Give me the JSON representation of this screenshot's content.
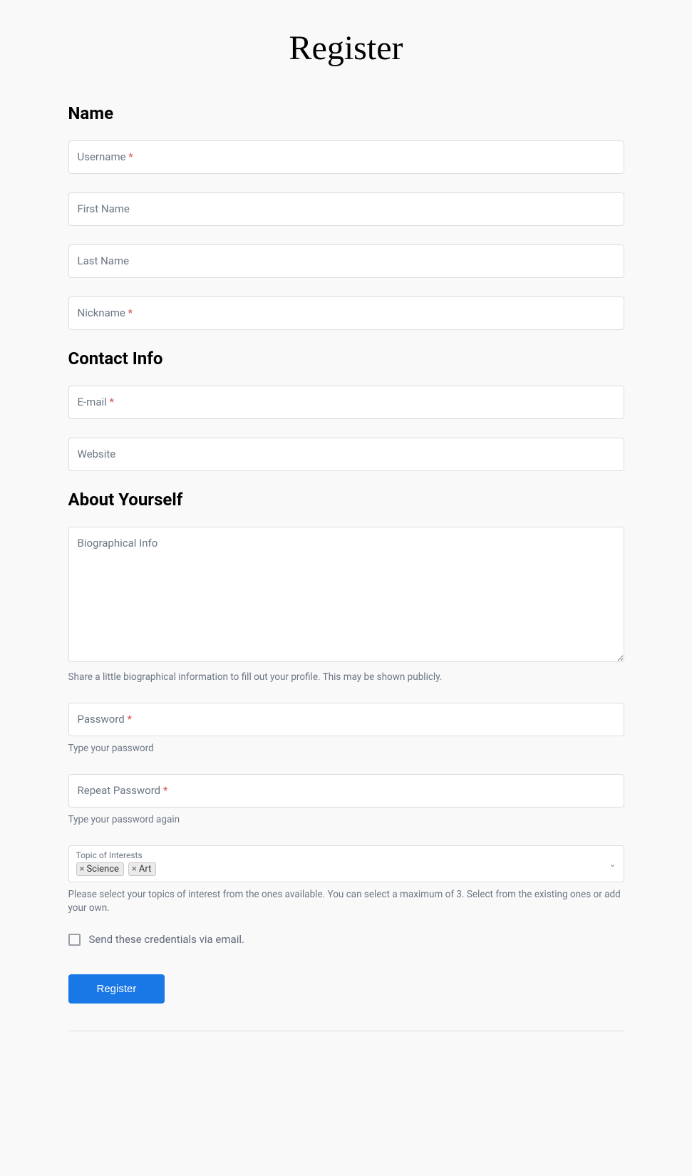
{
  "page_title": "Register",
  "sections": {
    "name": {
      "heading": "Name",
      "username_label": "Username",
      "first_name_label": "First Name",
      "last_name_label": "Last Name",
      "nickname_label": "Nickname"
    },
    "contact": {
      "heading": "Contact Info",
      "email_label": "E-mail",
      "website_label": "Website"
    },
    "about": {
      "heading": "About Yourself",
      "bio_label": "Biographical Info",
      "bio_help": "Share a little biographical information to fill out your profile. This may be shown publicly.",
      "password_label": "Password",
      "password_help": "Type your password",
      "repeat_password_label": "Repeat Password",
      "repeat_password_help": "Type your password again",
      "topics_label": "Topic of Interests",
      "topics_selected": [
        "Science",
        "Art"
      ],
      "topics_help": "Please select your topics of interest from the ones available. You can select a maximum of 3. Select from the existing ones or add your own."
    }
  },
  "send_credentials_label": "Send these credentials via email.",
  "submit_label": "Register",
  "required_marker": "*"
}
